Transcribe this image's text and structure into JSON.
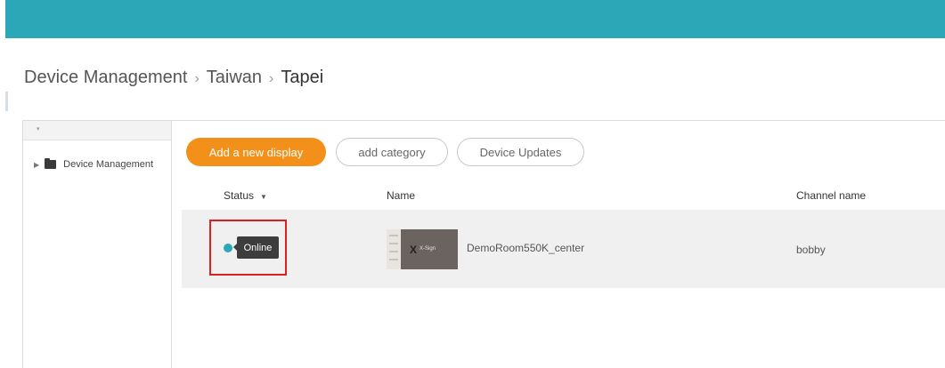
{
  "breadcrumb": {
    "items": [
      "Device Management",
      "Taiwan",
      "Tapei"
    ],
    "separator": "›"
  },
  "sidebar": {
    "tree": [
      {
        "label": "Device Management",
        "icon": "folder-icon",
        "expanded": false
      }
    ]
  },
  "toolbar": {
    "add_display_label": "Add a new display",
    "add_category_label": "add category",
    "device_updates_label": "Device Updates"
  },
  "table": {
    "columns": {
      "status": "Status",
      "name": "Name",
      "channel": "Channel name"
    },
    "rows": [
      {
        "status": "Online",
        "name": "DemoRoom550K_center",
        "channel": "bobby",
        "thumbnail_logo": "X",
        "thumbnail_text": "X-Sign"
      }
    ]
  },
  "colors": {
    "topbar": "#2ba7b8",
    "primary_button": "#f39019",
    "status_online": "#2ba7b8",
    "highlight": "#e02020",
    "tooltip_bg": "#3d3d3d"
  }
}
